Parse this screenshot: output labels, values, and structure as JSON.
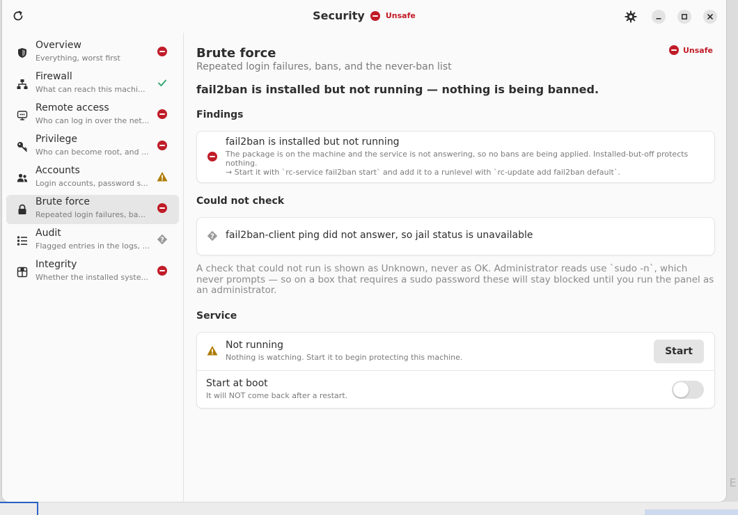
{
  "window": {
    "title": "Security",
    "status": "Unsafe"
  },
  "sidebar": {
    "items": [
      {
        "title": "Overview",
        "subtitle": "Everything, worst first",
        "state": "bad"
      },
      {
        "title": "Firewall",
        "subtitle": "What can reach this machi...",
        "state": "ok"
      },
      {
        "title": "Remote access",
        "subtitle": "Who can log in over the net...",
        "state": "bad"
      },
      {
        "title": "Privilege",
        "subtitle": "Who can become root, and ...",
        "state": "bad"
      },
      {
        "title": "Accounts",
        "subtitle": "Login accounts, password s...",
        "state": "warn"
      },
      {
        "title": "Brute force",
        "subtitle": "Repeated login failures, ba...",
        "state": "bad",
        "selected": true
      },
      {
        "title": "Audit",
        "subtitle": "Flagged entries in the logs, ...",
        "state": "unknown"
      },
      {
        "title": "Integrity",
        "subtitle": "Whether the installed syste...",
        "state": "bad"
      }
    ]
  },
  "page": {
    "title": "Brute force",
    "subtitle": "Repeated login failures, bans, and the never-ban list",
    "status": "Unsafe",
    "headline": "fail2ban is installed but not running — nothing is being banned."
  },
  "findings": {
    "heading": "Findings",
    "items": [
      {
        "title": "fail2ban is installed but not running",
        "body": "The package is on the machine and the service is not answering, so no bans are being applied. Installed-but-off protects nothing.",
        "action": "→ Start it with `rc-service fail2ban start` and add it to a runlevel with `rc-update add fail2ban default`.",
        "state": "bad"
      }
    ]
  },
  "could_not_check": {
    "heading": "Could not check",
    "items": [
      {
        "title": "fail2ban-client ping did not answer, so jail status is unavailable",
        "state": "unknown"
      }
    ],
    "note": "A check that could not run is shown as Unknown, never as OK. Administrator reads use `sudo -n`, which never prompts — so on a box that requires a sudo password these will stay blocked until you run the panel as an administrator."
  },
  "service": {
    "heading": "Service",
    "status_title": "Not running",
    "status_body": "Nothing is watching. Start it to begin protecting this machine.",
    "start_label": "Start",
    "boot_title": "Start at boot",
    "boot_body": "It will NOT come back after a restart.",
    "boot_enabled": false
  },
  "colors": {
    "bad": "#c01c28",
    "ok": "#26a269",
    "warn": "#ae7b03",
    "unknown": "#9a9a9a"
  },
  "background_text": "G E"
}
